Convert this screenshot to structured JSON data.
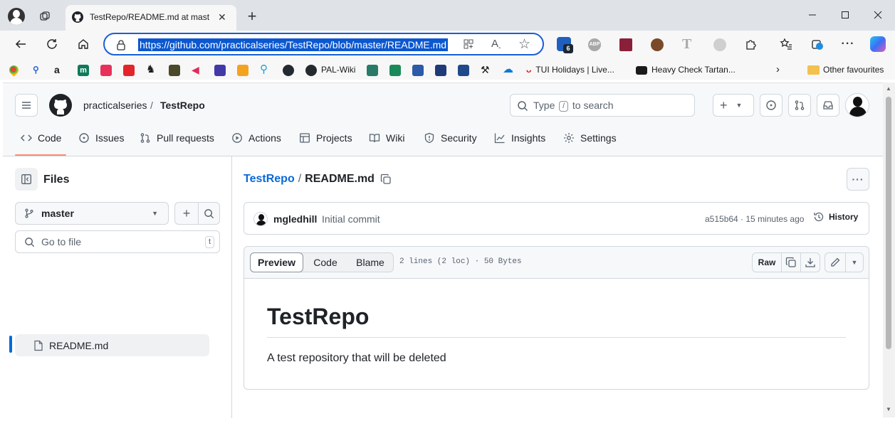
{
  "browser": {
    "tab_title": "TestRepo/README.md at master",
    "url": "https://github.com/practicalseries/TestRepo/blob/master/README.md",
    "extension_badge": "6",
    "favourites": [
      {
        "label": "PAL-Wiki"
      },
      {
        "label": "TUI Holidays | Live..."
      },
      {
        "label": "Heavy Check Tartan..."
      },
      {
        "label": "Other favourites"
      }
    ]
  },
  "header": {
    "owner": "practicalseries",
    "separator": "/",
    "repo": "TestRepo",
    "search_placeholder_pre": "Type",
    "search_key": "/",
    "search_placeholder_post": "to search"
  },
  "nav": {
    "items": [
      {
        "label": "Code"
      },
      {
        "label": "Issues"
      },
      {
        "label": "Pull requests"
      },
      {
        "label": "Actions"
      },
      {
        "label": "Projects"
      },
      {
        "label": "Wiki"
      },
      {
        "label": "Security"
      },
      {
        "label": "Insights"
      },
      {
        "label": "Settings"
      }
    ]
  },
  "sidebar": {
    "title": "Files",
    "branch": "master",
    "goto_placeholder": "Go to file",
    "goto_key": "t",
    "files": [
      {
        "name": "README.md"
      }
    ]
  },
  "file": {
    "repo_link": "TestRepo",
    "separator": "/",
    "filename": "README.md",
    "commit_author": "mgledhill",
    "commit_message": "Initial commit",
    "commit_meta": "a515b64 · 15 minutes ago",
    "history_label": "History",
    "view_tabs": [
      "Preview",
      "Code",
      "Blame"
    ],
    "stats": "2 lines (2 loc) · 50 Bytes",
    "raw_label": "Raw"
  },
  "readme": {
    "heading": "TestRepo",
    "body": "A test repository that will be deleted"
  },
  "colors": {
    "accent_blue": "#0969da",
    "tab_underline": "#fd8c73",
    "url_highlight": "#0b57d0"
  }
}
